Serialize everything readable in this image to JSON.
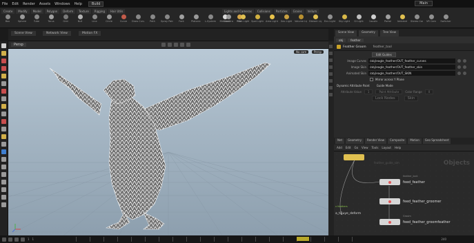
{
  "menubar": {
    "items": [
      "File",
      "Edit",
      "Render",
      "Assets",
      "Windows",
      "Help"
    ],
    "desktop": "Build",
    "right_title": "Main"
  },
  "shelf": {
    "left_tabs": [
      "Create",
      "Modify",
      "Model",
      "Polygon",
      "Deform",
      "Texture",
      "Rigging",
      "Hair Utils"
    ],
    "left_tools": [
      {
        "label": "Box",
        "icon": "box-icon",
        "color": "#8a8a8a"
      },
      {
        "label": "Sphere",
        "icon": "sphere-icon",
        "color": "#9a9a9a"
      },
      {
        "label": "Tube",
        "icon": "tube-icon",
        "color": "#8a8a8a"
      },
      {
        "label": "Torus",
        "icon": "torus-icon",
        "color": "#a0a0a0"
      },
      {
        "label": "Grid",
        "icon": "grid-icon",
        "color": "#7a7a7a"
      },
      {
        "label": "Null",
        "icon": "null-icon",
        "color": "#b0b0b0"
      },
      {
        "label": "Line",
        "icon": "line-icon",
        "color": "#8a8a8a"
      },
      {
        "label": "Circle",
        "icon": "circle-icon",
        "color": "#999999"
      },
      {
        "label": "Curve",
        "icon": "curve-icon",
        "color": "#c25b4a"
      },
      {
        "label": "Draw Curve",
        "icon": "draw-curve-icon",
        "color": "#888888"
      },
      {
        "label": "Path",
        "icon": "path-icon",
        "color": "#888888"
      },
      {
        "label": "Spray Paint",
        "icon": "spray-paint-icon",
        "color": "#888888"
      },
      {
        "label": "Font",
        "icon": "font-icon",
        "color": "#a0a0a0"
      },
      {
        "label": "Platonic",
        "icon": "platonic-icon",
        "color": "#999999"
      },
      {
        "label": "L-System",
        "icon": "l-system-icon",
        "color": "#888888"
      },
      {
        "label": "Metaball",
        "icon": "metaball-icon",
        "color": "#d8d8d8"
      },
      {
        "label": "File",
        "icon": "file-icon",
        "color": "#d4a64a"
      }
    ],
    "right_tabs": [
      "Lights and Cameras",
      "Collisions",
      "Particles",
      "Grains",
      "Vellum"
    ],
    "right_tools": [
      {
        "label": "Camera",
        "icon": "camera-icon",
        "color": "#9a9a9a"
      },
      {
        "label": "Point Light",
        "icon": "point-light-icon",
        "color": "#e0c050"
      },
      {
        "label": "Spot Light",
        "icon": "spot-light-icon",
        "color": "#d0b040"
      },
      {
        "label": "Area Light",
        "icon": "area-light-icon",
        "color": "#e8c24a"
      },
      {
        "label": "Geo Light",
        "icon": "geo-light-icon",
        "color": "#c8a040"
      },
      {
        "label": "Volume Light",
        "icon": "volume-light-icon",
        "color": "#b89030"
      },
      {
        "label": "Distant Light",
        "icon": "distant-light-icon",
        "color": "#e0c050"
      },
      {
        "label": "Env Light",
        "icon": "env-light-icon",
        "color": "#909090"
      },
      {
        "label": "Sky Light",
        "icon": "sky-light-icon",
        "color": "#d8b848"
      },
      {
        "label": "GI Light",
        "icon": "gi-light-icon",
        "color": "#c0c0c0"
      },
      {
        "label": "Caustic",
        "icon": "caustic-light-icon",
        "color": "#d0d0d0"
      },
      {
        "label": "Portal",
        "icon": "portal-light-icon",
        "color": "#a0a0a0"
      },
      {
        "label": "Ambient",
        "icon": "ambient-light-icon",
        "color": "#e0c050"
      },
      {
        "label": "Stereo Cam",
        "icon": "stereo-camera-icon",
        "color": "#909090"
      },
      {
        "label": "VR Cam",
        "icon": "vr-camera-icon",
        "color": "#909090"
      },
      {
        "label": "Switcher",
        "icon": "switcher-icon",
        "color": "#909090"
      }
    ]
  },
  "viewport": {
    "pane_tabs": [
      "Scene View",
      "Network View",
      "Motion FX"
    ],
    "camera": "Persp",
    "badges": [
      "No cam",
      "Persp"
    ]
  },
  "params": {
    "tabs": [
      "Scene View",
      "Geometry",
      "Tree View"
    ],
    "path": [
      "obj",
      "feather"
    ],
    "node_type": "Feather Groom",
    "node_name": "feather_tool",
    "btn": "Edit Guides",
    "fields": [
      {
        "label": "Image Curves",
        "value": "/obj/eagle_feather/OUT_feather_curves"
      },
      {
        "label": "Image Skin",
        "value": "/obj/eagle_feather/OUT_feather_skin"
      },
      {
        "label": "Animated Skin",
        "value": "/obj/eagle_feather/OUT_SKIN"
      }
    ],
    "check_label": "Mirror across Y Plane",
    "section_a": "Dynamic Attribute Paint",
    "section_b": "Guide Mode",
    "dim_rows": [
      [
        "Attribute Value",
        "1",
        "Paint Attribute",
        "Color Range",
        "0"
      ],
      [
        "Lock Nodes",
        "Skin"
      ]
    ]
  },
  "network": {
    "tabs": [
      "Net",
      "Geometry",
      "Render View",
      "Composite",
      "Motion",
      "Geo Spreadsheet"
    ],
    "menu": [
      "Add",
      "Edit",
      "Go",
      "View",
      "Tools",
      "Layout",
      "Help"
    ],
    "objects_watermark": "Objects",
    "ghost_label": "feather_guide_sim",
    "nodes": [
      {
        "label": "feed_feather",
        "sub": "feather_lock",
        "color": "#d6d6d6"
      },
      {
        "label": "feed_feather_groomer",
        "sub": "",
        "color": "#d6d6d6"
      },
      {
        "label": "feed_feather_groomfeather",
        "sub": "Groom",
        "color": "#d6d6d6"
      }
    ],
    "top_node": {
      "color": "#e0c050"
    },
    "left_label": "a_tijjuye_deform",
    "left_label_small": "x feathers"
  },
  "timeline": {
    "frame": "1",
    "start": "1",
    "end": "240"
  },
  "colors": {
    "accent": "#e0c050",
    "node_flag": "#e05a5a",
    "node_ok": "#8bc34a"
  }
}
